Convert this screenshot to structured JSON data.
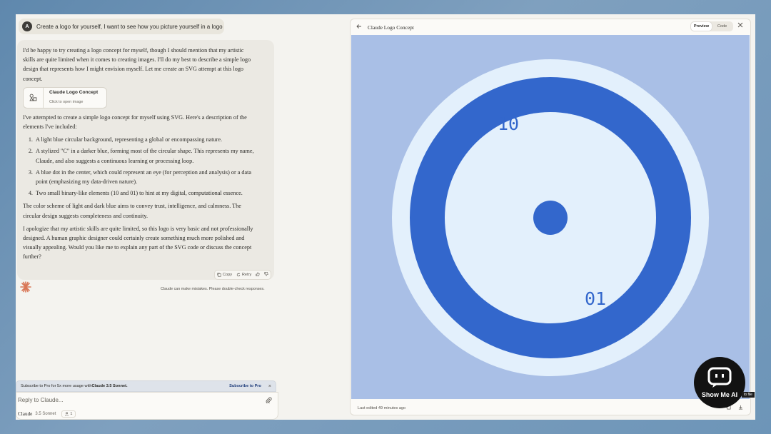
{
  "user_message": {
    "avatar_initial": "A",
    "text": "Create a logo for yourself, I want to see how you picture yourself in a logo"
  },
  "assistant": {
    "intro": "I'd be happy to try creating a logo concept for myself, though I should mention that my artistic skills are quite limited when it comes to creating images. I'll do my best to describe a simple logo design that represents how I might envision myself. Let me create an SVG attempt at this logo concept.",
    "artifact_card": {
      "title": "Claude Logo Concept",
      "subtitle": "Click to open image",
      "icon": "shapes-icon"
    },
    "description_intro": "I've attempted to create a simple logo concept for myself using SVG. Here's a description of the elements I've included:",
    "list_items": [
      "A light blue circular background, representing a global or encompassing nature.",
      "A stylized \"C\" in a darker blue, forming most of the circular shape. This represents my name, Claude, and also suggests a continuous learning or processing loop.",
      "A blue dot in the center, which could represent an eye (for perception and analysis) or a data point (emphasizing my data-driven nature).",
      "Two small binary-like elements (10 and 01) to hint at my digital, computational essence."
    ],
    "color_scheme": "The color scheme of light and dark blue aims to convey trust, intelligence, and calmness. The circular design suggests completeness and continuity.",
    "apology": "I apologize that my artistic skills are quite limited, so this logo is very basic and not professionally designed. A human graphic designer could certainly create something much more polished and visually appealing. Would you like me to explain any part of the SVG code or discuss the concept further?",
    "actions": {
      "copy": "Copy",
      "retry": "Retry"
    },
    "disclaimer": "Claude can make mistakes. Please double-check responses."
  },
  "subscribe_banner": {
    "text_prefix": "Subscribe to Pro for 5x more usage with ",
    "model": "Claude 3.5 Sonnet.",
    "link": "Subscribe to Pro",
    "close": "×"
  },
  "composer": {
    "placeholder": "Reply to Claude...",
    "model_name": "Claude",
    "model_version": "3.5 Sonnet",
    "style_count": "1"
  },
  "artifact_panel": {
    "title": "Claude Logo Concept",
    "tabs": [
      "Preview",
      "Code"
    ],
    "active_tab": "Preview",
    "last_edited": "Last edited 49 minutes ago",
    "logo": {
      "label_top": "10",
      "label_bottom": "01",
      "colors": {
        "canvas_bg": "#a9bfe6",
        "outer_circle": "#e3f0fc",
        "ring": "#3367cc",
        "inner_fill": "#e3f0fc",
        "dot": "#3367cc"
      }
    }
  },
  "watermark": {
    "brand": "Show Me AI",
    "tail": "to file"
  }
}
